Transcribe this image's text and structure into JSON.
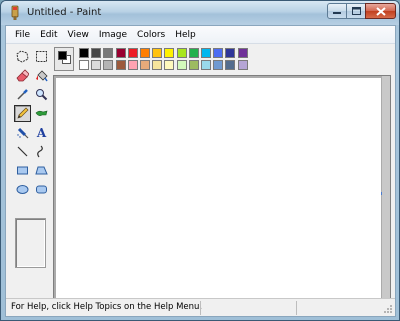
{
  "window": {
    "title": "Untitled - Paint"
  },
  "menu": {
    "items": [
      "File",
      "Edit",
      "View",
      "Image",
      "Colors",
      "Help"
    ]
  },
  "tools": [
    {
      "name": "free-form-select-icon"
    },
    {
      "name": "select-icon"
    },
    {
      "name": "eraser-icon"
    },
    {
      "name": "fill-with-color-icon"
    },
    {
      "name": "pick-color-icon"
    },
    {
      "name": "magnifier-icon"
    },
    {
      "name": "pencil-icon",
      "selected": true
    },
    {
      "name": "brush-icon"
    },
    {
      "name": "airbrush-icon"
    },
    {
      "name": "text-icon",
      "label": "A"
    },
    {
      "name": "line-icon"
    },
    {
      "name": "curve-icon"
    },
    {
      "name": "rectangle-icon"
    },
    {
      "name": "polygon-icon"
    },
    {
      "name": "ellipse-icon"
    },
    {
      "name": "rounded-rectangle-icon"
    }
  ],
  "palette": {
    "foreground": "#000000",
    "background": "#ffffff",
    "row1": [
      "#000000",
      "#464646",
      "#787878",
      "#990030",
      "#ed1c24",
      "#ff7e00",
      "#ffc20e",
      "#fff200",
      "#a8e61d",
      "#22b14c",
      "#00b7ef",
      "#4d6df3",
      "#2f3699",
      "#6f3198"
    ],
    "row2": [
      "#ffffff",
      "#dcdcdc",
      "#b4b4b4",
      "#9c5a3c",
      "#ffa3b1",
      "#e5aa7a",
      "#f5e49c",
      "#fff9bd",
      "#d3f9bc",
      "#9dbb61",
      "#99d9ea",
      "#709ad1",
      "#546d8e",
      "#b5a5d5"
    ]
  },
  "status": {
    "help_text": "For Help, click Help Topics on the Help Menu."
  }
}
